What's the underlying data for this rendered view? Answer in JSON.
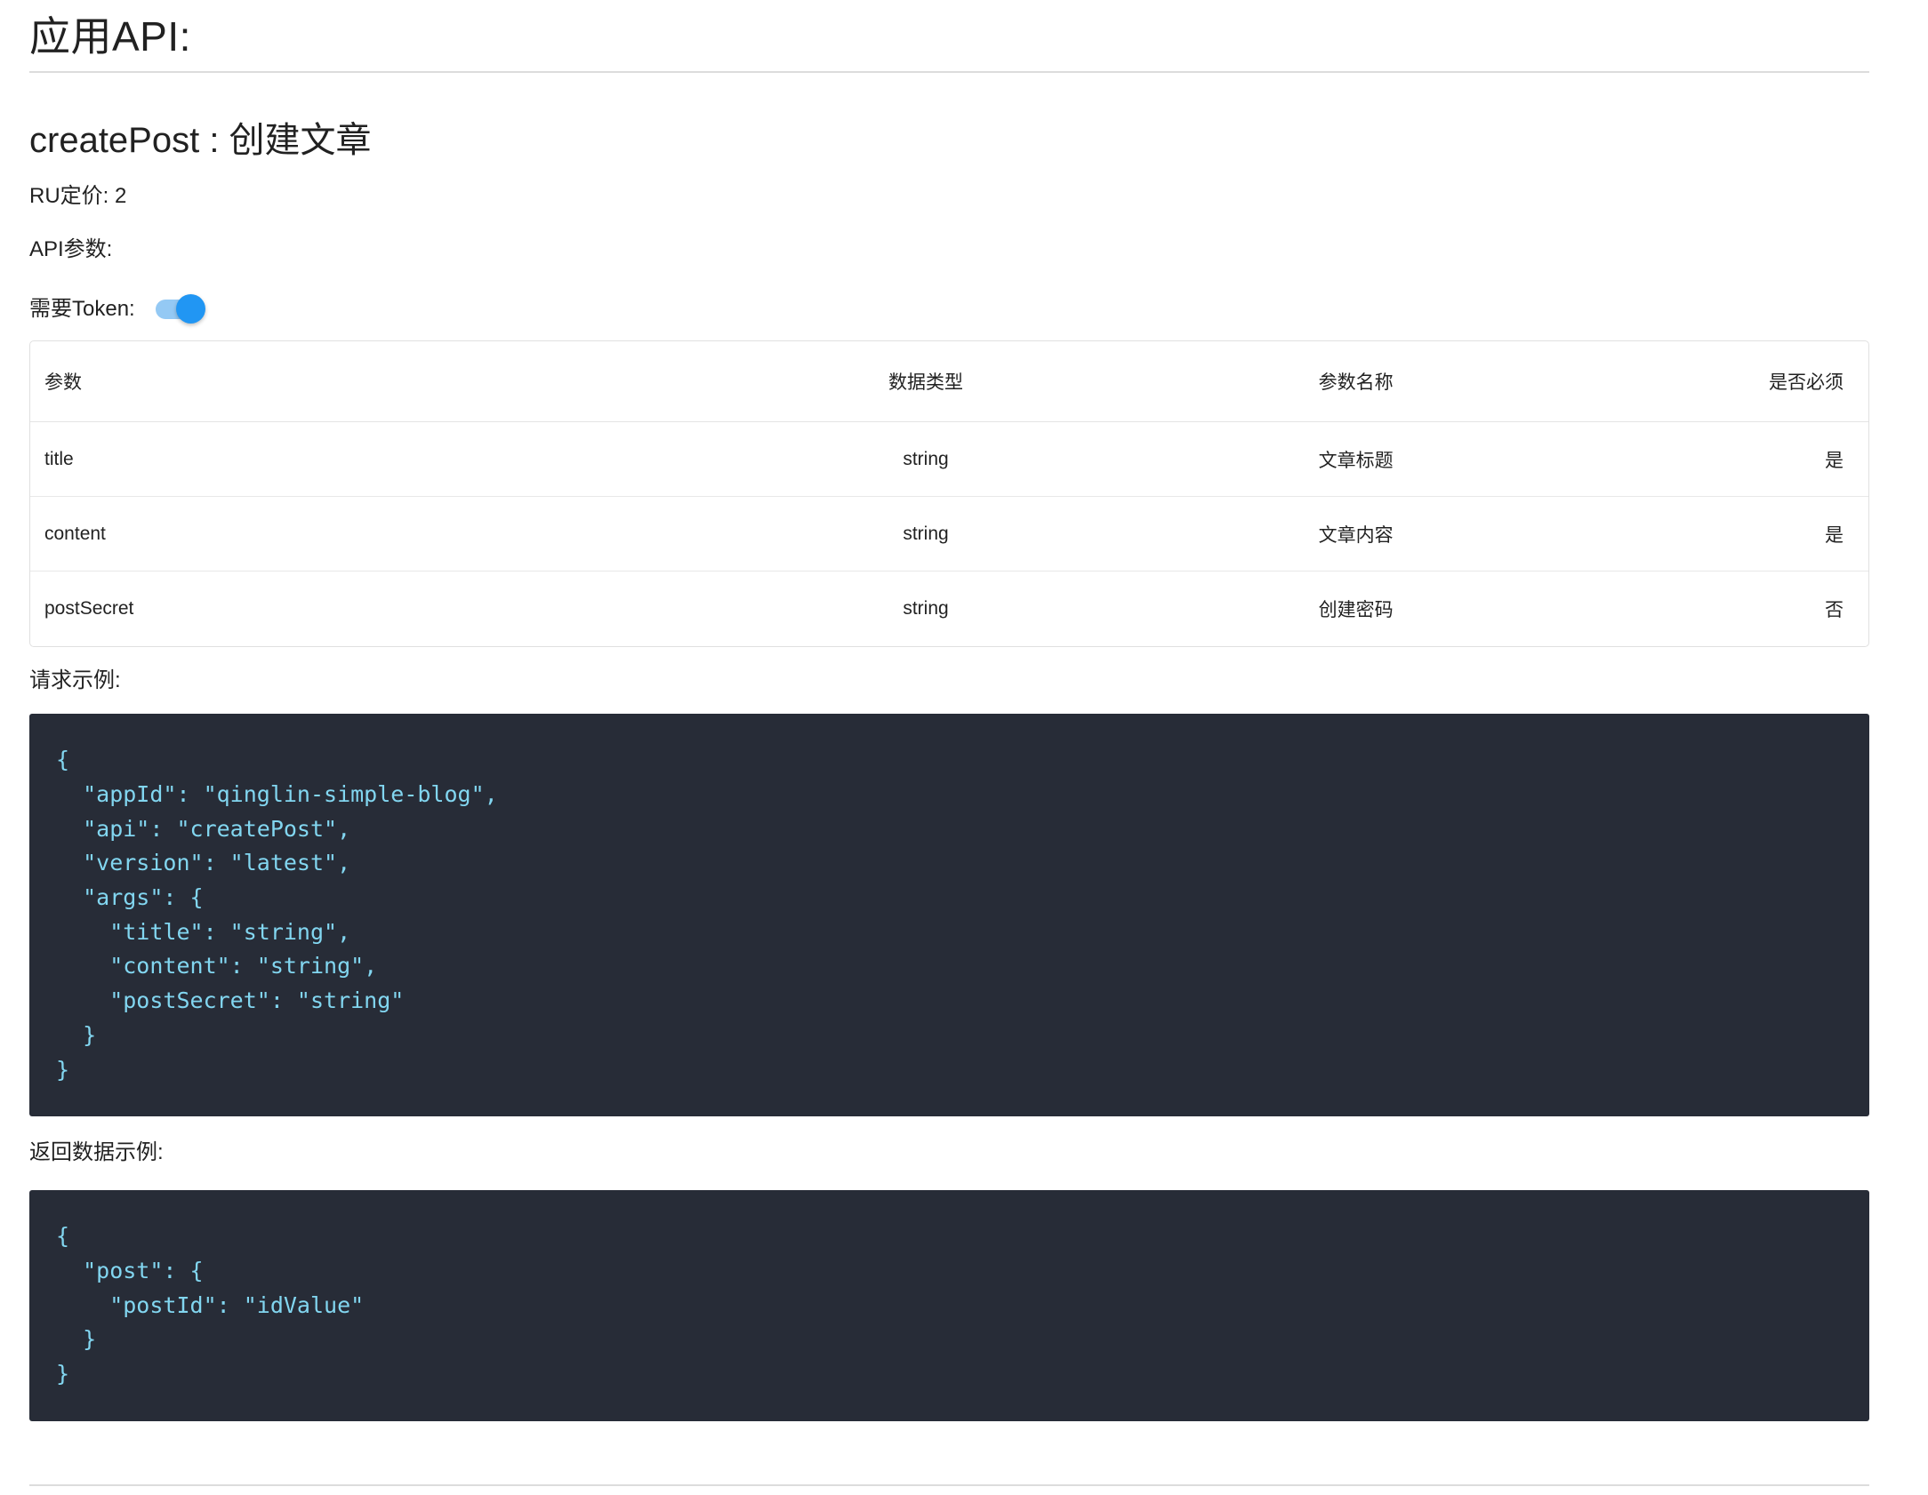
{
  "page": {
    "title": "应用API:"
  },
  "api": {
    "heading": "createPost : 创建文章",
    "pricing": "RU定价: 2",
    "params_label": "API参数:",
    "token_label": "需要Token:",
    "token_enabled": true
  },
  "table": {
    "headers": [
      "参数",
      "数据类型",
      "参数名称",
      "是否必须"
    ],
    "rows": [
      {
        "param": "title",
        "type": "string",
        "name": "文章标题",
        "required": "是"
      },
      {
        "param": "content",
        "type": "string",
        "name": "文章内容",
        "required": "是"
      },
      {
        "param": "postSecret",
        "type": "string",
        "name": "创建密码",
        "required": "否"
      }
    ]
  },
  "request": {
    "label": "请求示例:",
    "code": "{\n  \"appId\": \"qinglin-simple-blog\",\n  \"api\": \"createPost\",\n  \"version\": \"latest\",\n  \"args\": {\n    \"title\": \"string\",\n    \"content\": \"string\",\n    \"postSecret\": \"string\"\n  }\n}"
  },
  "response": {
    "label": "返回数据示例:",
    "code": "{\n  \"post\": {\n    \"postId\": \"idValue\"\n  }\n}"
  },
  "colors": {
    "switch_thumb": "#2196f3",
    "switch_track": "#94c9f4",
    "code_background": "#272c37",
    "code_text": "#82d6f0",
    "divider": "#dcdcdc",
    "table_border": "#e0e0e0"
  }
}
